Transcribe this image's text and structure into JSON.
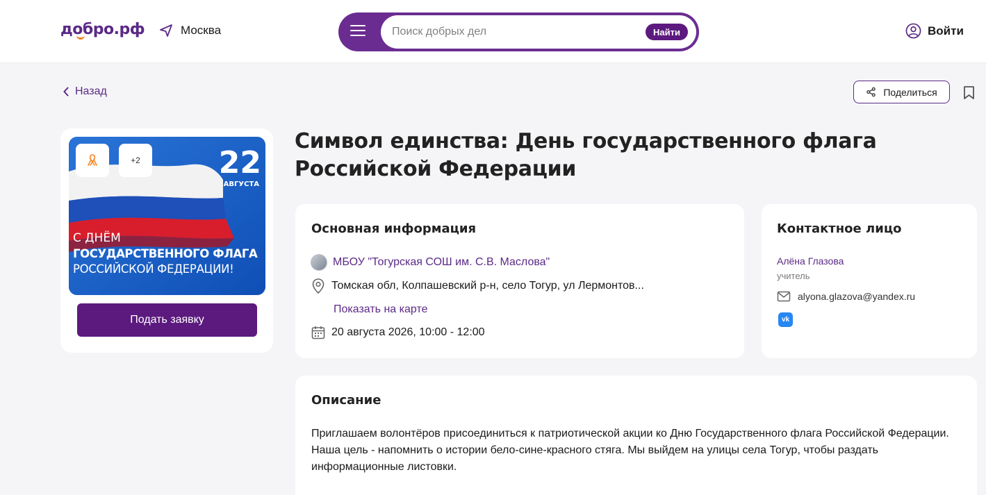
{
  "header": {
    "logo": "добро.рф",
    "city": "Москва",
    "search": {
      "placeholder": "Поиск добрых дел",
      "button_label": "Найти"
    },
    "login_label": "Войти"
  },
  "nav": {
    "back_label": "Назад",
    "share_label": "Поделиться"
  },
  "event": {
    "title": "Символ единства: День государственного флага Российской Федерации",
    "image": {
      "day": "22",
      "month": "АВГУСТА",
      "line1": "С ДНЁМ",
      "line2": "ГОСУДАРСТВЕННОГО ФЛАГА",
      "line3": "РОССИЙСКОЙ ФЕДЕРАЦИИ!"
    },
    "chip_more": "+2",
    "apply_label": "Подать заявку"
  },
  "info": {
    "heading": "Основная информация",
    "organization": "МБОУ \"Тогурская СОШ им. С.В. Маслова\"",
    "address": "Томская обл, Колпашевский р-н, село Тогур, ул Лермонтов...",
    "map_link": "Показать на карте",
    "datetime": "20 августа 2026, 10:00 - 12:00"
  },
  "contact": {
    "heading": "Контактное лицо",
    "name": "Алёна Глазова",
    "role": "учитель",
    "email": "alyona.glazova@yandex.ru"
  },
  "description": {
    "heading": "Описание",
    "text": "Приглашаем волонтёров присоединиться к патриотической акции ко Дню Государственного флага Российской Федерации. Наша цель - напомнить о истории бело-сине-красного стяга. Мы выйдем на улицы села Тогур, чтобы раздать информационные листовки."
  },
  "colors": {
    "brand": "#5b2a86",
    "search_bar": "#6b2c91",
    "button": "#5c1a7e",
    "accent_orange": "#f5821f",
    "background": "#f5f5f7"
  },
  "icons": [
    "location-arrow-icon",
    "menu-icon",
    "user-icon",
    "chevron-left-icon",
    "share-icon",
    "bookmark-icon",
    "ribbon-icon",
    "pin-icon",
    "calendar-icon",
    "mail-icon",
    "vk-icon"
  ]
}
